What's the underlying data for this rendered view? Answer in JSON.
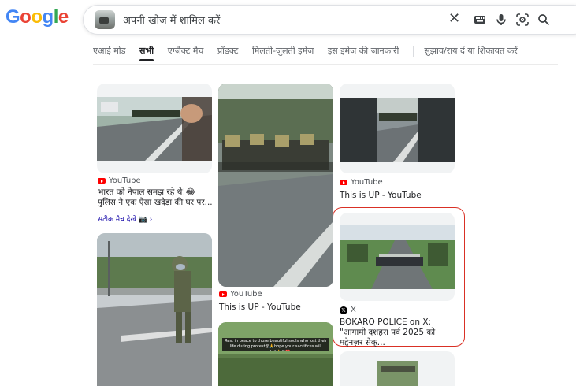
{
  "logo": {
    "letters": [
      "G",
      "o",
      "o",
      "g",
      "l",
      "e"
    ]
  },
  "search": {
    "query": "अपनी खोज में शामिल करें"
  },
  "icons": {
    "clear": "close-icon",
    "keyboard": "keyboard-icon",
    "voice": "microphone-icon",
    "lens": "lens-icon",
    "search": "search-icon"
  },
  "tabs": [
    {
      "label": "एआई मोड"
    },
    {
      "label": "सभी"
    },
    {
      "label": "एग्ज़ैक्ट मैच"
    },
    {
      "label": "प्रॉडक्ट"
    },
    {
      "label": "मिलती-जुलती इमेज"
    },
    {
      "label": "इस इमेज की जानकारी"
    },
    {
      "label": "सुझाव/राय दें या शिकायत करें"
    }
  ],
  "results": [
    {
      "source": "YouTube",
      "title": "भारत को नेपाल समझ रहे थे!😂 पुलिस ने एक ऐसा खदेड़ा की घर पर...",
      "exact": "सटीक मैच देखें 📷 ›"
    },
    {
      "source": "YouTube",
      "title": "This is UP - YouTube"
    },
    {
      "source": "YouTube",
      "title": "This is UP - YouTube"
    },
    {
      "source": "X",
      "title": "BOKARO POLICE on X: \"आगामी दशहरा पर्व 2025 को मद्देनज़र सेक्..."
    }
  ],
  "overlay_caption": "Rest in peace to those beautiful souls who lost their life during protest😢🙏hope your sacrifices will worth it🙏😢❤️"
}
